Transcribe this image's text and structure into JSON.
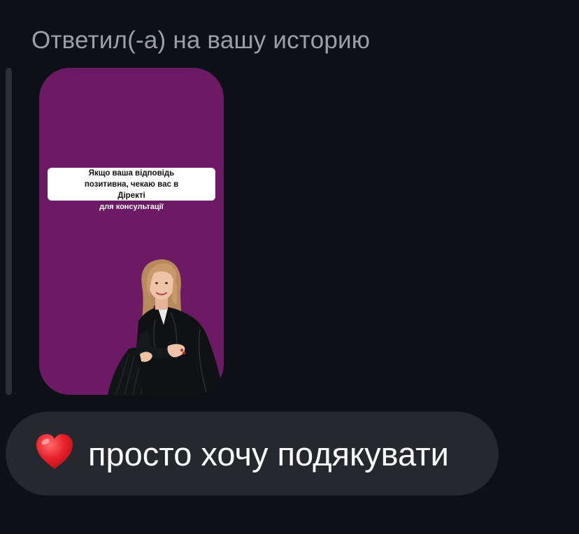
{
  "reply": {
    "header": "Ответил(-а) на вашу историю"
  },
  "story": {
    "question": "Якщо ваша відповідь позитивна, чекаю вас в Діректі",
    "caption": "для консультації",
    "background_color": "#6b1a63"
  },
  "message": {
    "emoji_icon": "heart-icon",
    "text": "просто хочу подякувати"
  }
}
